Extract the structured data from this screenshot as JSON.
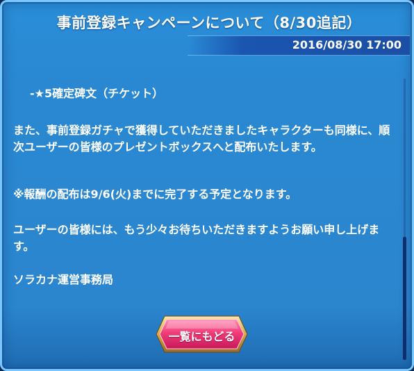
{
  "header": {
    "title": "事前登録キャンペーンについて（8/30追記）",
    "date": "2016/08/30 17:00"
  },
  "content": {
    "clipped_line": "-★5確定碑文（チケット）",
    "paragraphs": [
      "また、事前登録ガチャで獲得していただきましたキャラクターも同様に、順次ユーザーの皆様のプレゼントボックスへと配布いたします。",
      "※報酬の配布は9/6(火)までに完了する予定となります。",
      "ユーザーの皆様には、もう少々お待ちいただきますようお願い申し上げます。",
      "ソラカナ運営事務局"
    ]
  },
  "back_button": {
    "label": "一覧にもどる"
  },
  "colors": {
    "panel": "#2a88d2",
    "border": "#78c8ff",
    "button": "#e8336e"
  }
}
